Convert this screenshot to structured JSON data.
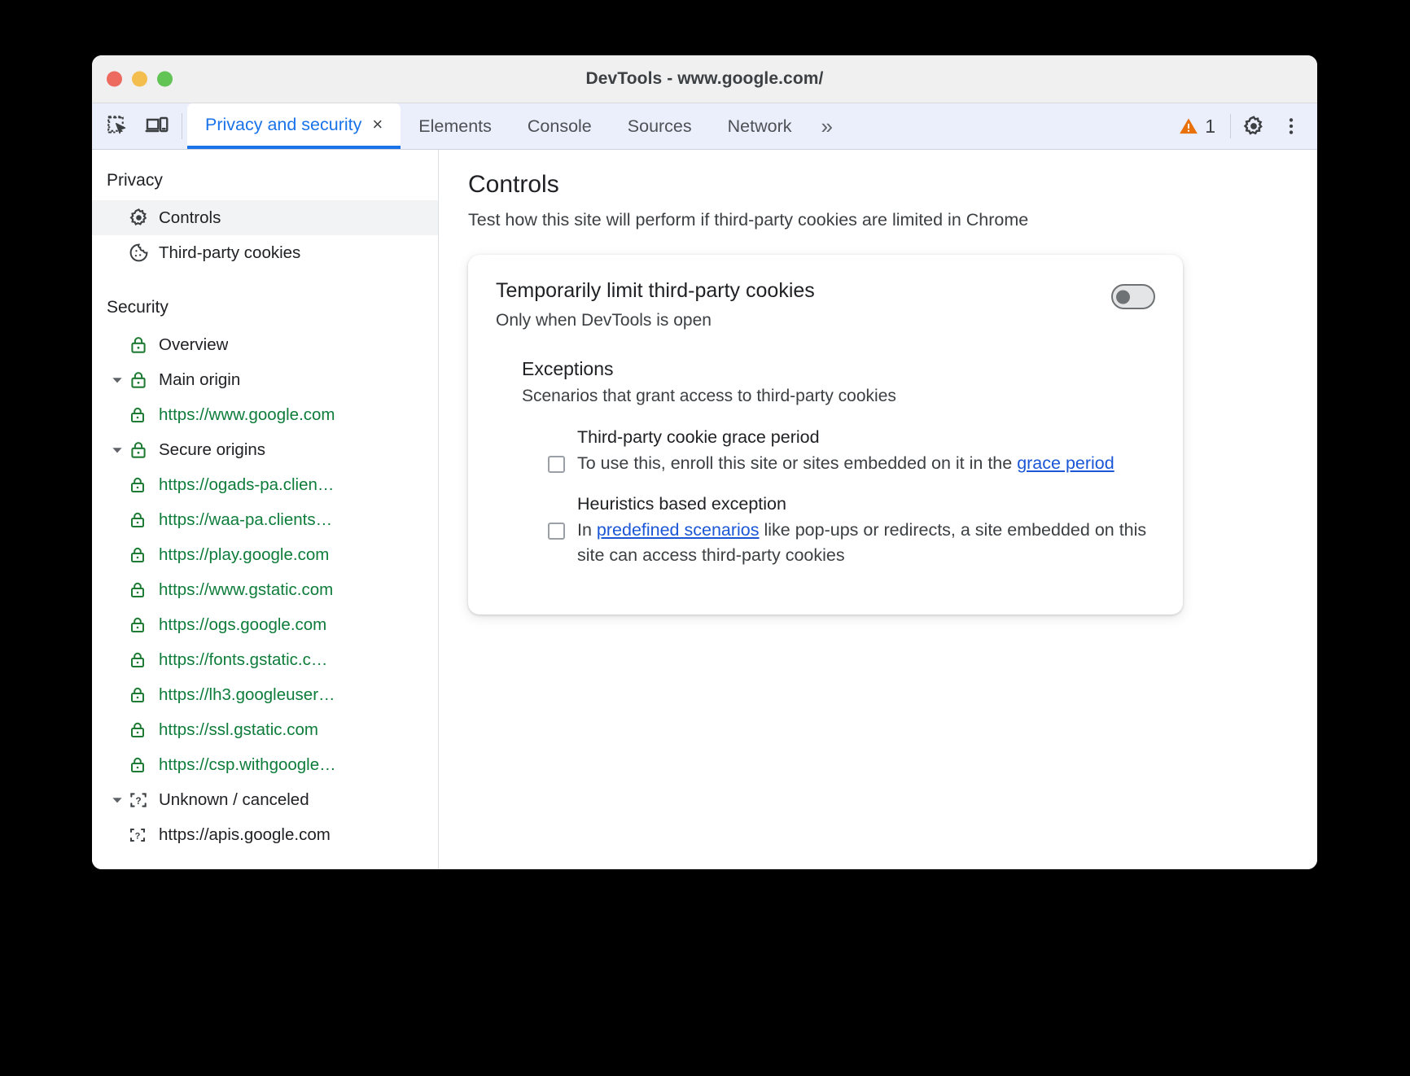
{
  "window": {
    "title": "DevTools - www.google.com/",
    "traffic_lights": [
      "close",
      "minimize",
      "maximize"
    ]
  },
  "toolbar": {
    "inspect_icon": "inspect-element-icon",
    "device_icon": "device-toolbar-icon",
    "tabs": [
      {
        "label": "Privacy and security",
        "active": true,
        "closable": true,
        "close_label": "×"
      },
      {
        "label": "Elements",
        "active": false
      },
      {
        "label": "Console",
        "active": false
      },
      {
        "label": "Sources",
        "active": false
      },
      {
        "label": "Network",
        "active": false
      }
    ],
    "more_tabs_label": "»",
    "warning_count": "1",
    "warning_color": "#e8710a",
    "settings_icon": "gear-icon",
    "more_options_icon": "three-dot-menu-icon"
  },
  "sidebar": {
    "sections": [
      {
        "title": "Privacy",
        "items": [
          {
            "label": "Controls",
            "icon": "gear-icon",
            "selected": true,
            "kind": "nav"
          },
          {
            "label": "Third-party cookies",
            "icon": "cookie-icon",
            "selected": false,
            "kind": "nav"
          }
        ]
      },
      {
        "title": "Security",
        "items": [
          {
            "label": "Overview",
            "icon": "lock-icon",
            "kind": "nav",
            "indent": 1
          },
          {
            "label": "Main origin",
            "icon": "lock-icon",
            "kind": "group",
            "expanded": true,
            "indent": 0
          },
          {
            "label": "https://www.google.com",
            "icon": "lock-icon",
            "kind": "url",
            "indent": 2
          },
          {
            "label": "Secure origins",
            "icon": "lock-icon",
            "kind": "group",
            "expanded": true,
            "indent": 0
          },
          {
            "label": "https://ogads-pa.clien…",
            "icon": "lock-icon",
            "kind": "url",
            "indent": 2
          },
          {
            "label": "https://waa-pa.clients…",
            "icon": "lock-icon",
            "kind": "url",
            "indent": 2
          },
          {
            "label": "https://play.google.com",
            "icon": "lock-icon",
            "kind": "url",
            "indent": 2
          },
          {
            "label": "https://www.gstatic.com",
            "icon": "lock-icon",
            "kind": "url",
            "indent": 2
          },
          {
            "label": "https://ogs.google.com",
            "icon": "lock-icon",
            "kind": "url",
            "indent": 2
          },
          {
            "label": "https://fonts.gstatic.c…",
            "icon": "lock-icon",
            "kind": "url",
            "indent": 2
          },
          {
            "label": "https://lh3.googleuser…",
            "icon": "lock-icon",
            "kind": "url",
            "indent": 2
          },
          {
            "label": "https://ssl.gstatic.com",
            "icon": "lock-icon",
            "kind": "url",
            "indent": 2
          },
          {
            "label": "https://csp.withgoogle…",
            "icon": "lock-icon",
            "kind": "url",
            "indent": 2
          },
          {
            "label": "Unknown / canceled",
            "icon": "unknown-icon",
            "kind": "group",
            "expanded": true,
            "indent": 0
          },
          {
            "label": "https://apis.google.com",
            "icon": "unknown-icon",
            "kind": "url-unknown",
            "indent": 2
          }
        ]
      }
    ]
  },
  "main": {
    "title": "Controls",
    "subtitle": "Test how this site will perform if third-party cookies are limited in Chrome",
    "card": {
      "title": "Temporarily limit third-party cookies",
      "subtitle": "Only when DevTools is open",
      "toggle": {
        "name": "limit-third-party-cookies-toggle",
        "state": "off"
      },
      "exceptions": {
        "title": "Exceptions",
        "subtitle": "Scenarios that grant access to third-party cookies",
        "items": [
          {
            "name": "Third-party cookie grace period",
            "checked": false,
            "desc_before": "To use this, enroll this site or sites embedded on it in the ",
            "link": "grace period",
            "desc_after": ""
          },
          {
            "name": "Heuristics based exception",
            "checked": false,
            "desc_before": "In ",
            "link": "predefined scenarios",
            "desc_after": " like pop-ups or redirects, a site embedded on this site can access third-party cookies"
          }
        ]
      }
    }
  },
  "colors": {
    "accent": "#1a73e8",
    "link": "#1a56d6",
    "secure_green": "#0e7c3a",
    "warning_orange": "#e8710a",
    "toolbar_bg": "#ebeffb"
  }
}
